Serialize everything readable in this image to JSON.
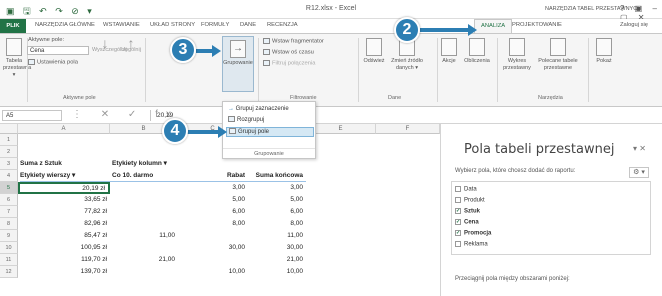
{
  "titlebar": {
    "qat_icons": "▣ 🖫 ↶ ↷ ⊘ ▾",
    "doc_title": "R12.xlsx - Excel",
    "context_group": "NARZĘDZIA TABEL PRZESTAWNYCH",
    "window_buttons": "? ▣ – ▢ ✕"
  },
  "tabs": {
    "file": "PLIK",
    "home": "NARZĘDZIA GŁÓWNE",
    "insert": "WSTAWIANIE",
    "layout": "UKŁAD STRONY",
    "formulas": "FORMUŁY",
    "data": "DANE",
    "review": "RECENZJA",
    "analyze": "ANALIZA",
    "design": "PROJEKTOWANIE",
    "signin": "Zaloguj się"
  },
  "ribbon": {
    "pivot_table_btn": "Tabela przestawna ▾",
    "active_field_label": "Aktywne pole:",
    "active_field_value": "Cena",
    "field_settings": "Ustawienia pola",
    "drill_down": "Wyszczególnij",
    "drill_up": "Uogólnij",
    "grouping_btn": "Grupowanie",
    "group_active_label": "Aktywne pole",
    "insert_slicer": "Wstaw fragmentator",
    "insert_timeline": "Wstaw oś czasu",
    "filter_connections": "Filtruj połączenia",
    "filtering_label": "Filtrowanie",
    "refresh": "Odśwież",
    "change_source": "Zmień źródło danych ▾",
    "data_label": "Dane",
    "actions": "Akcje",
    "calculations": "Obliczenia",
    "pivot_chart": "Wykres przestawny",
    "recommended": "Polecane tabele przestawne",
    "tools_label": "Narzędzia",
    "show": "Pokaż"
  },
  "formula_bar": {
    "name_box": "A5",
    "fx_icons": "⋮ ✕ ✓ fx",
    "value": "20,19"
  },
  "menu": {
    "item_group_selection": "Grupuj zaznaczenie",
    "item_ungroup": "Rozgrupuj",
    "item_group_field": "Grupuj pole",
    "group_label": "Grupowanie"
  },
  "sheet": {
    "columns": [
      "A",
      "B",
      "C",
      "D",
      "E",
      "F"
    ],
    "rows": [
      "1",
      "2",
      "3",
      "4",
      "5",
      "6",
      "7",
      "8",
      "9",
      "10",
      "11",
      "12"
    ],
    "row3": {
      "a": "Suma z Sztuk",
      "b": "Etykiety kolumn ▾"
    },
    "row4": {
      "a": "Etykiety wierszy ▾",
      "b": "Co 10. darmo",
      "c": "Rabat",
      "d": "Suma końcowa"
    },
    "data": [
      {
        "a": "20,19 zł",
        "b": "",
        "c": "3,00",
        "d": "3,00"
      },
      {
        "a": "33,65 zł",
        "b": "",
        "c": "5,00",
        "d": "5,00"
      },
      {
        "a": "77,82 zł",
        "b": "",
        "c": "6,00",
        "d": "6,00"
      },
      {
        "a": "82,96 zł",
        "b": "",
        "c": "8,00",
        "d": "8,00"
      },
      {
        "a": "85,47 zł",
        "b": "11,00",
        "c": "",
        "d": "11,00"
      },
      {
        "a": "100,95 zł",
        "b": "",
        "c": "30,00",
        "d": "30,00"
      },
      {
        "a": "119,70 zł",
        "b": "21,00",
        "c": "",
        "d": "21,00"
      },
      {
        "a": "139,70 zł",
        "b": "",
        "c": "10,00",
        "d": "10,00"
      }
    ]
  },
  "pane": {
    "title": "Pola tabeli przestawnej",
    "close": "▾ ✕",
    "subtitle": "Wybierz pola, które chcesz dodać do raportu:",
    "gear": "⚙ ▾",
    "fields": [
      {
        "name": "Data",
        "checked": "",
        "bold": false
      },
      {
        "name": "Produkt",
        "checked": "",
        "bold": false
      },
      {
        "name": "Sztuk",
        "checked": "✓",
        "bold": true
      },
      {
        "name": "Cena",
        "checked": "✓",
        "bold": true
      },
      {
        "name": "Promocja",
        "checked": "✓",
        "bold": true
      },
      {
        "name": "Reklama",
        "checked": "",
        "bold": false
      }
    ],
    "drag_hint": "Przeciągnij pola między obszarami poniżej:"
  },
  "callouts": {
    "c2": "2",
    "c3": "3",
    "c4": "4"
  },
  "colors": {
    "accent": "#217346",
    "callout": "#2c7eb3",
    "highlight": "#d5e8f4"
  }
}
